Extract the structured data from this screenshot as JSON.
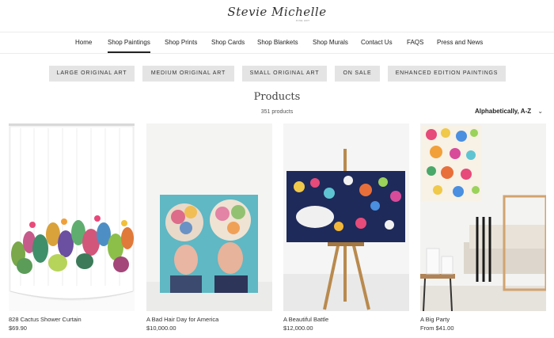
{
  "brand": {
    "logo_text": "Stevie Michelle",
    "logo_sub": "FINE ART"
  },
  "nav": {
    "items": [
      {
        "label": "Home"
      },
      {
        "label": "Shop Paintings"
      },
      {
        "label": "Shop Prints"
      },
      {
        "label": "Shop Cards"
      },
      {
        "label": "Shop Blankets"
      },
      {
        "label": "Shop Murals"
      },
      {
        "label": "Contact Us"
      },
      {
        "label": "FAQS"
      },
      {
        "label": "Press and News"
      }
    ],
    "active": "Shop Paintings"
  },
  "categories": [
    {
      "label": "LARGE ORIGINAL ART"
    },
    {
      "label": "MEDIUM ORIGINAL ART"
    },
    {
      "label": "SMALL ORIGINAL ART"
    },
    {
      "label": "ON SALE"
    },
    {
      "label": "ENHANCED EDITION PAINTINGS"
    }
  ],
  "collection": {
    "title": "Products",
    "count": "351 products",
    "sort_label": "Alphabetically, A-Z"
  },
  "products": [
    {
      "name": "828 Cactus Shower Curtain",
      "price": "$69.90"
    },
    {
      "name": "A Bad Hair Day for America",
      "price": "$10,000.00"
    },
    {
      "name": "A Beautiful Battle",
      "price": "$12,000.00"
    },
    {
      "name": "A Big Party",
      "price": "From $41.00"
    }
  ],
  "icons": {
    "sort": "chevron-down-icon"
  }
}
